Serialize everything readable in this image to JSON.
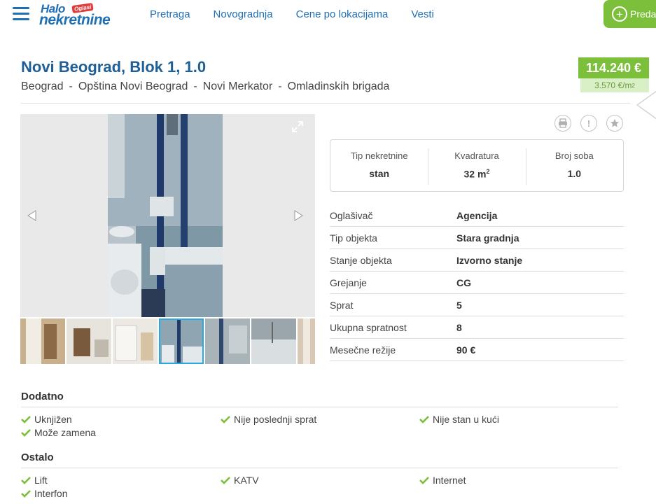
{
  "header": {
    "logo_top": "Halo",
    "logo_badge": "Oglasi",
    "logo_bottom": "nekretnine",
    "nav": [
      "Pretraga",
      "Novogradnja",
      "Cene po lokacijama",
      "Vesti"
    ],
    "cta_label": "Preda"
  },
  "listing": {
    "title": "Novi Beograd, Blok 1, 1.0",
    "location": [
      "Beograd",
      "Opština Novi Beograd",
      "Novi Merkator",
      "Omladinskih brigada"
    ],
    "price": "114.240 €",
    "price_per_m2": "3.570 €/m",
    "price_per_m2_sup": "2"
  },
  "summary": [
    {
      "label": "Tip nekretnine",
      "value": "stan",
      "sup": ""
    },
    {
      "label": "Kvadratura",
      "value": "32 m",
      "sup": "2"
    },
    {
      "label": "Broj soba",
      "value": "1.0",
      "sup": ""
    }
  ],
  "details": [
    {
      "label": "Oglašivač",
      "value": "Agencija"
    },
    {
      "label": "Tip objekta",
      "value": "Stara gradnja"
    },
    {
      "label": "Stanje objekta",
      "value": "Izvorno stanje"
    },
    {
      "label": "Grejanje",
      "value": "CG"
    },
    {
      "label": "Sprat",
      "value": "5"
    },
    {
      "label": "Ukupna spratnost",
      "value": "8"
    },
    {
      "label": "Mesečne režije",
      "value": "90 €"
    }
  ],
  "gallery": {
    "thumb_count": 7,
    "active_thumb": 4
  },
  "sections": {
    "dodatno": {
      "title": "Dodatno",
      "items": [
        "Uknjižen",
        "Nije poslednji sprat",
        "Nije stan u kući",
        "Može zamena"
      ]
    },
    "ostalo": {
      "title": "Ostalo",
      "items": [
        "Lift",
        "KATV",
        "Internet",
        "Interfon"
      ]
    }
  },
  "colors": {
    "brand_blue": "#1f6fb5",
    "price_green": "#7bbf3a",
    "check_green": "#7bbf3a"
  }
}
